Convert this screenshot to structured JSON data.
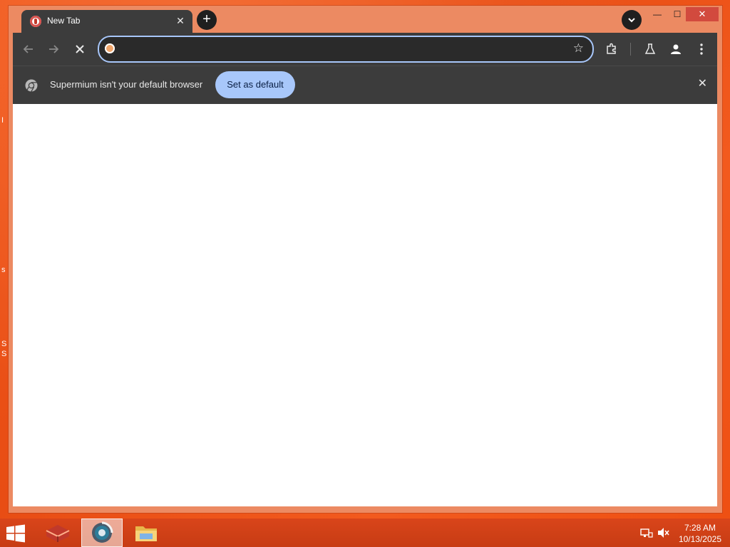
{
  "window": {
    "tab": {
      "title": "New Tab"
    },
    "controls": {
      "minimize": "—",
      "maximize": "☐",
      "close": "✕"
    }
  },
  "toolbar": {
    "omnibox": {
      "value": "",
      "placeholder": ""
    }
  },
  "infobar": {
    "message": "Supermium isn't your default browser",
    "button_label": "Set as default"
  },
  "taskbar": {
    "apps": [
      "app-launcher",
      "supermium-browser",
      "file-explorer"
    ],
    "active_app": "supermium-browser"
  },
  "clock": {
    "time": "7:28 AM",
    "date": "10/13/2025"
  },
  "colors": {
    "desktop": "#ec5318",
    "toolbar": "#3c3c3c",
    "accent": "#a8c7fa",
    "close": "#d24a3e"
  }
}
